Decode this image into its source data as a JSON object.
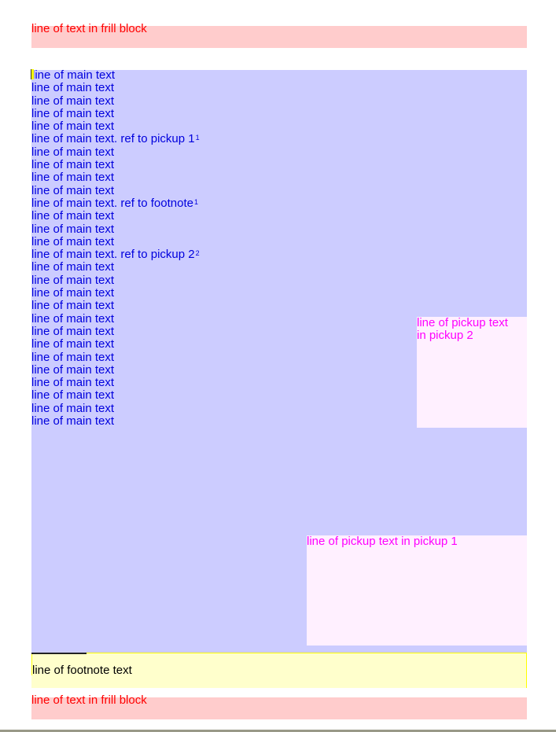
{
  "frill_top": {
    "text": "line of text in frill block"
  },
  "main": {
    "lines": [
      {
        "text": "line of main text"
      },
      {
        "text": "line of main text"
      },
      {
        "text": "line of main text"
      },
      {
        "text": "line of main text"
      },
      {
        "text": "line of main text"
      },
      {
        "text": "line of main text. ref to pickup 1",
        "sup": "1"
      },
      {
        "text": "line of main text"
      },
      {
        "text": "line of main text"
      },
      {
        "text": "line of main text"
      },
      {
        "text": "line of main text"
      },
      {
        "text": "line of main text. ref to footnote",
        "sup": "1"
      },
      {
        "text": "line of main text"
      },
      {
        "text": "line of main text"
      },
      {
        "text": "line of main text"
      },
      {
        "text": "line of main text. ref to pickup 2",
        "sup": "2"
      },
      {
        "text": "line of main text"
      },
      {
        "text": "line of main text"
      },
      {
        "text": "line of main text"
      },
      {
        "text": "line of main text"
      },
      {
        "text": "line of main text"
      },
      {
        "text": "line of main text"
      },
      {
        "text": "line of main text"
      },
      {
        "text": "line of main text"
      },
      {
        "text": "line of main text"
      },
      {
        "text": "line of main text"
      },
      {
        "text": "line of main text"
      },
      {
        "text": "line of main text"
      },
      {
        "text": "line of main text"
      }
    ]
  },
  "pickup2": {
    "lines": [
      "line of pickup text",
      "in pickup 2"
    ]
  },
  "pickup1": {
    "text": "line of pickup text in pickup 1"
  },
  "footnote": {
    "text": "line of footnote text"
  },
  "frill_bottom": {
    "text": "line of text in frill block"
  },
  "colors": {
    "main_bg": "#ccccff",
    "main_text": "#0000dd",
    "frill_bg": "#ffcccc",
    "frill_text": "#ff0000",
    "pickup_bg": "#fff0ff",
    "pickup_text": "#ff00ff",
    "footnote_bg": "#ffffcc"
  }
}
